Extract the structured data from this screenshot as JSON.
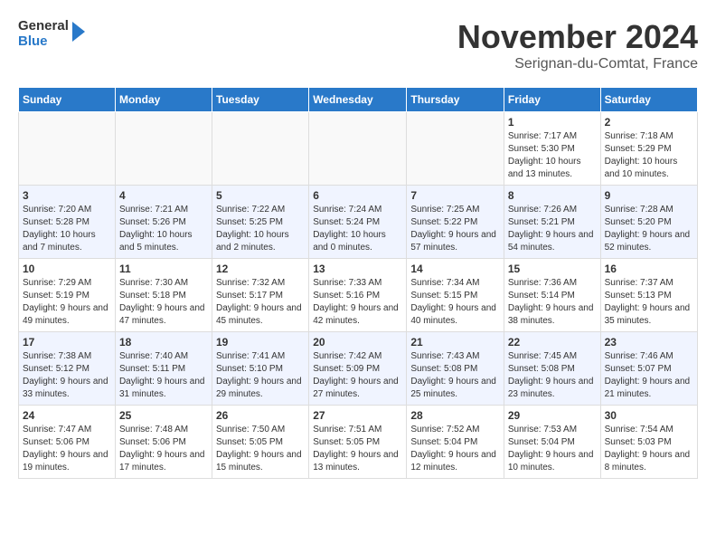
{
  "header": {
    "logo_line1": "General",
    "logo_line2": "Blue",
    "month": "November 2024",
    "location": "Serignan-du-Comtat, France"
  },
  "weekdays": [
    "Sunday",
    "Monday",
    "Tuesday",
    "Wednesday",
    "Thursday",
    "Friday",
    "Saturday"
  ],
  "weeks": [
    [
      {
        "day": "",
        "info": ""
      },
      {
        "day": "",
        "info": ""
      },
      {
        "day": "",
        "info": ""
      },
      {
        "day": "",
        "info": ""
      },
      {
        "day": "",
        "info": ""
      },
      {
        "day": "1",
        "info": "Sunrise: 7:17 AM\nSunset: 5:30 PM\nDaylight: 10 hours and 13 minutes."
      },
      {
        "day": "2",
        "info": "Sunrise: 7:18 AM\nSunset: 5:29 PM\nDaylight: 10 hours and 10 minutes."
      }
    ],
    [
      {
        "day": "3",
        "info": "Sunrise: 7:20 AM\nSunset: 5:28 PM\nDaylight: 10 hours and 7 minutes."
      },
      {
        "day": "4",
        "info": "Sunrise: 7:21 AM\nSunset: 5:26 PM\nDaylight: 10 hours and 5 minutes."
      },
      {
        "day": "5",
        "info": "Sunrise: 7:22 AM\nSunset: 5:25 PM\nDaylight: 10 hours and 2 minutes."
      },
      {
        "day": "6",
        "info": "Sunrise: 7:24 AM\nSunset: 5:24 PM\nDaylight: 10 hours and 0 minutes."
      },
      {
        "day": "7",
        "info": "Sunrise: 7:25 AM\nSunset: 5:22 PM\nDaylight: 9 hours and 57 minutes."
      },
      {
        "day": "8",
        "info": "Sunrise: 7:26 AM\nSunset: 5:21 PM\nDaylight: 9 hours and 54 minutes."
      },
      {
        "day": "9",
        "info": "Sunrise: 7:28 AM\nSunset: 5:20 PM\nDaylight: 9 hours and 52 minutes."
      }
    ],
    [
      {
        "day": "10",
        "info": "Sunrise: 7:29 AM\nSunset: 5:19 PM\nDaylight: 9 hours and 49 minutes."
      },
      {
        "day": "11",
        "info": "Sunrise: 7:30 AM\nSunset: 5:18 PM\nDaylight: 9 hours and 47 minutes."
      },
      {
        "day": "12",
        "info": "Sunrise: 7:32 AM\nSunset: 5:17 PM\nDaylight: 9 hours and 45 minutes."
      },
      {
        "day": "13",
        "info": "Sunrise: 7:33 AM\nSunset: 5:16 PM\nDaylight: 9 hours and 42 minutes."
      },
      {
        "day": "14",
        "info": "Sunrise: 7:34 AM\nSunset: 5:15 PM\nDaylight: 9 hours and 40 minutes."
      },
      {
        "day": "15",
        "info": "Sunrise: 7:36 AM\nSunset: 5:14 PM\nDaylight: 9 hours and 38 minutes."
      },
      {
        "day": "16",
        "info": "Sunrise: 7:37 AM\nSunset: 5:13 PM\nDaylight: 9 hours and 35 minutes."
      }
    ],
    [
      {
        "day": "17",
        "info": "Sunrise: 7:38 AM\nSunset: 5:12 PM\nDaylight: 9 hours and 33 minutes."
      },
      {
        "day": "18",
        "info": "Sunrise: 7:40 AM\nSunset: 5:11 PM\nDaylight: 9 hours and 31 minutes."
      },
      {
        "day": "19",
        "info": "Sunrise: 7:41 AM\nSunset: 5:10 PM\nDaylight: 9 hours and 29 minutes."
      },
      {
        "day": "20",
        "info": "Sunrise: 7:42 AM\nSunset: 5:09 PM\nDaylight: 9 hours and 27 minutes."
      },
      {
        "day": "21",
        "info": "Sunrise: 7:43 AM\nSunset: 5:08 PM\nDaylight: 9 hours and 25 minutes."
      },
      {
        "day": "22",
        "info": "Sunrise: 7:45 AM\nSunset: 5:08 PM\nDaylight: 9 hours and 23 minutes."
      },
      {
        "day": "23",
        "info": "Sunrise: 7:46 AM\nSunset: 5:07 PM\nDaylight: 9 hours and 21 minutes."
      }
    ],
    [
      {
        "day": "24",
        "info": "Sunrise: 7:47 AM\nSunset: 5:06 PM\nDaylight: 9 hours and 19 minutes."
      },
      {
        "day": "25",
        "info": "Sunrise: 7:48 AM\nSunset: 5:06 PM\nDaylight: 9 hours and 17 minutes."
      },
      {
        "day": "26",
        "info": "Sunrise: 7:50 AM\nSunset: 5:05 PM\nDaylight: 9 hours and 15 minutes."
      },
      {
        "day": "27",
        "info": "Sunrise: 7:51 AM\nSunset: 5:05 PM\nDaylight: 9 hours and 13 minutes."
      },
      {
        "day": "28",
        "info": "Sunrise: 7:52 AM\nSunset: 5:04 PM\nDaylight: 9 hours and 12 minutes."
      },
      {
        "day": "29",
        "info": "Sunrise: 7:53 AM\nSunset: 5:04 PM\nDaylight: 9 hours and 10 minutes."
      },
      {
        "day": "30",
        "info": "Sunrise: 7:54 AM\nSunset: 5:03 PM\nDaylight: 9 hours and 8 minutes."
      }
    ]
  ]
}
